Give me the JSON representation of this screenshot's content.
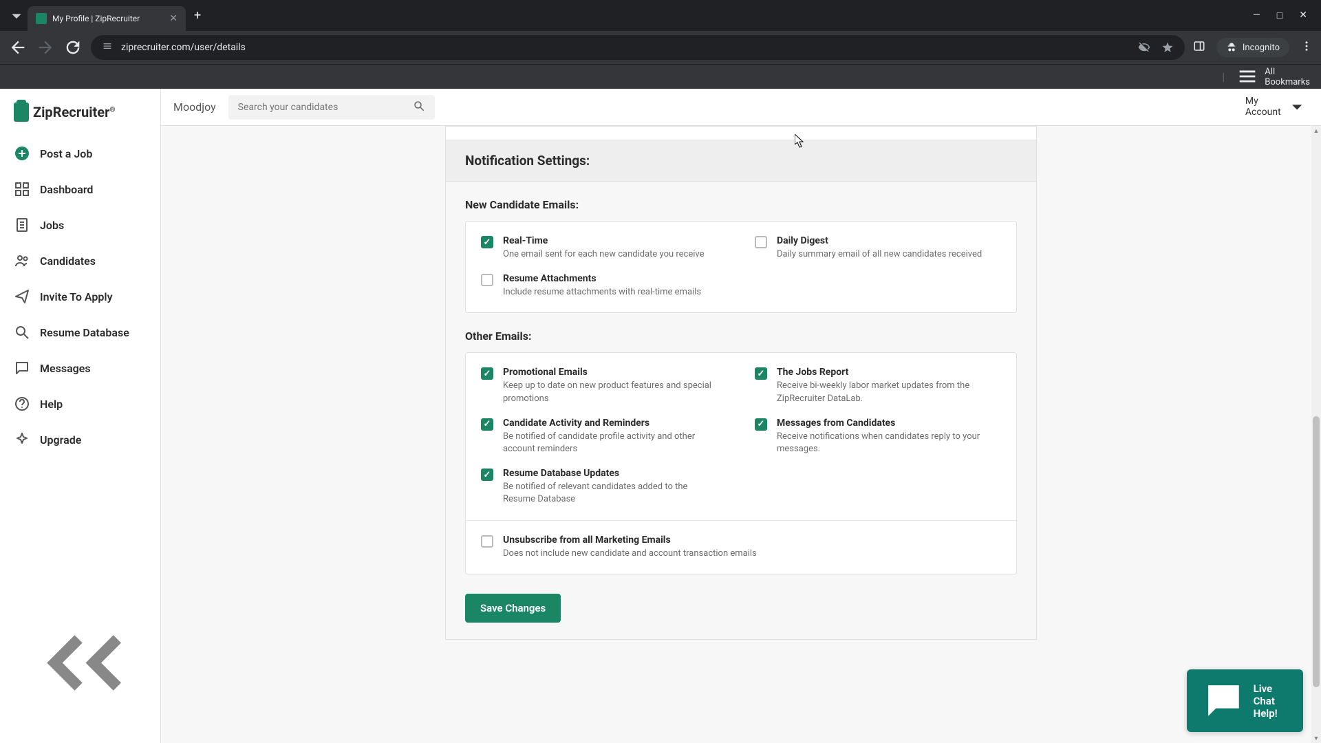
{
  "browser": {
    "tab_title": "My Profile | ZipRecruiter",
    "url": "ziprecruiter.com/user/details",
    "incognito_label": "Incognito",
    "bookmarks_label": "All Bookmarks"
  },
  "sidebar": {
    "logo_text": "ZipRecruiter",
    "items": [
      {
        "label": "Post a Job"
      },
      {
        "label": "Dashboard"
      },
      {
        "label": "Jobs"
      },
      {
        "label": "Candidates"
      },
      {
        "label": "Invite To Apply"
      },
      {
        "label": "Resume Database"
      },
      {
        "label": "Messages"
      },
      {
        "label": "Help"
      },
      {
        "label": "Upgrade"
      }
    ]
  },
  "header": {
    "brand": "Moodjoy",
    "search_placeholder": "Search your candidates",
    "account_label": "My Account"
  },
  "settings": {
    "section_title": "Notification Settings:",
    "new_candidate_title": "New Candidate Emails:",
    "new_candidate_options": [
      {
        "label": "Real-Time",
        "desc": "One email sent for each new candidate you receive",
        "checked": true
      },
      {
        "label": "Daily Digest",
        "desc": "Daily summary email of all new candidates received",
        "checked": false
      },
      {
        "label": "Resume Attachments",
        "desc": "Include resume attachments with real-time emails",
        "checked": false
      }
    ],
    "other_title": "Other Emails:",
    "other_options": [
      {
        "label": "Promotional Emails",
        "desc": "Keep up to date on new product features and special promotions",
        "checked": true
      },
      {
        "label": "The Jobs Report",
        "desc": "Receive bi-weekly labor market updates from the ZipRecruiter DataLab.",
        "checked": true
      },
      {
        "label": "Candidate Activity and Reminders",
        "desc": "Be notified of candidate profile activity and other account reminders",
        "checked": true
      },
      {
        "label": "Messages from Candidates",
        "desc": "Receive notifications when candidates reply to your messages.",
        "checked": true
      },
      {
        "label": "Resume Database Updates",
        "desc": "Be notified of relevant candidates added to the Resume Database",
        "checked": true
      }
    ],
    "unsubscribe": {
      "label": "Unsubscribe from all Marketing Emails",
      "desc": "Does not include new candidate and account transaction emails",
      "checked": false
    },
    "save_label": "Save Changes"
  },
  "chat_label": "Live Chat Help!"
}
